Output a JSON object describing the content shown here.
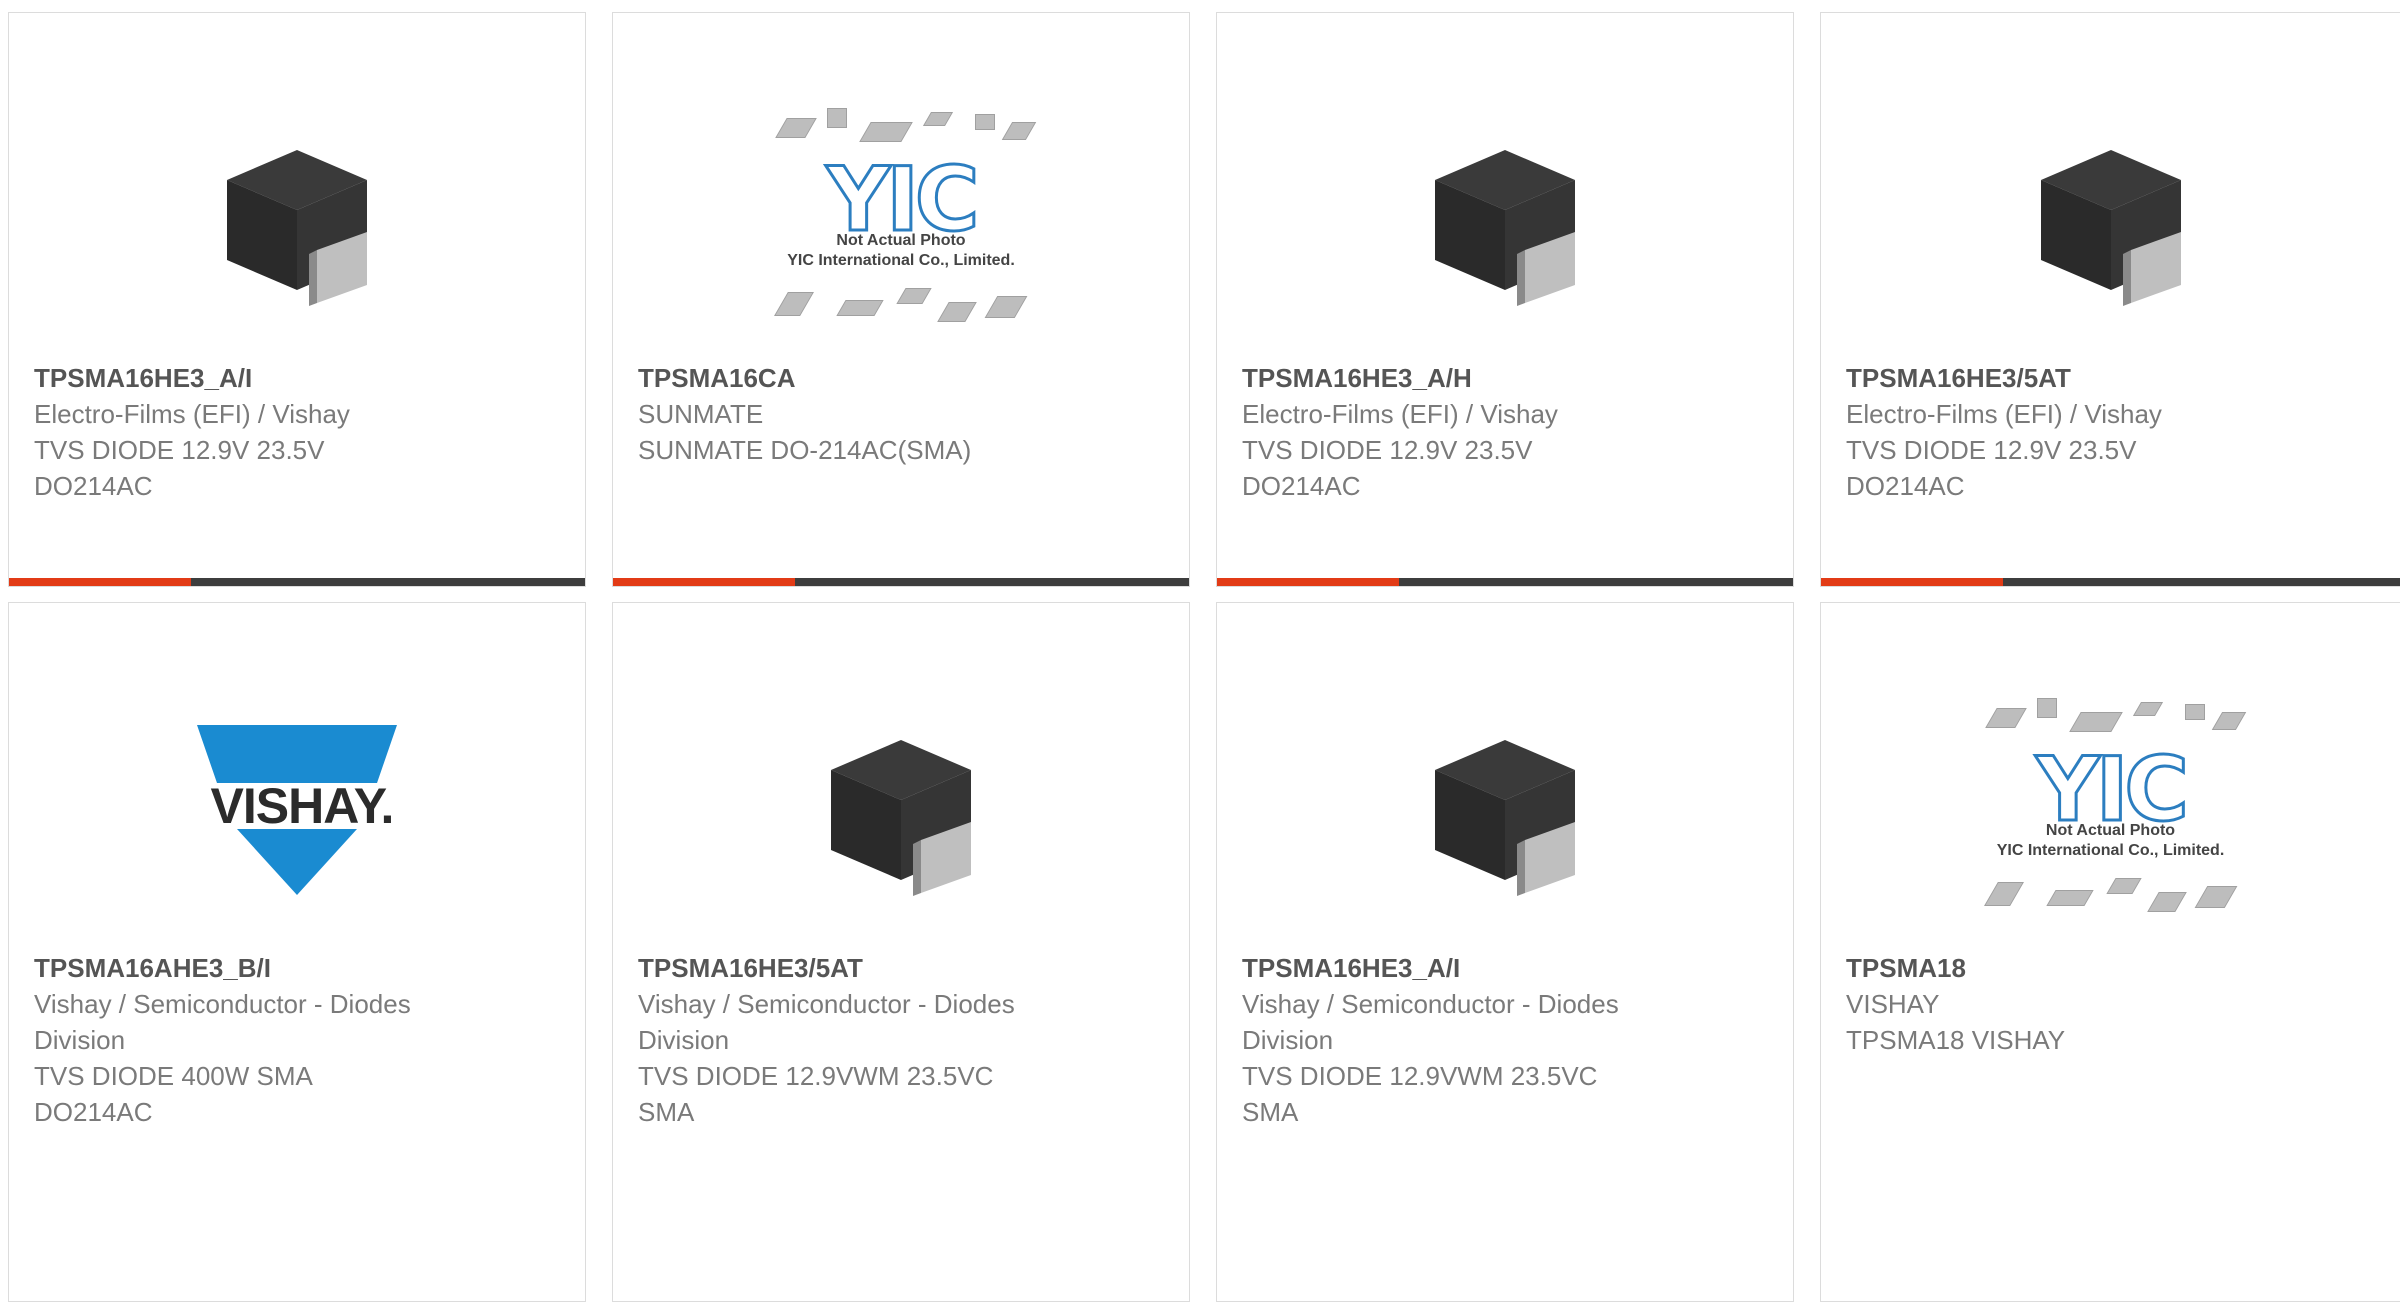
{
  "products": [
    {
      "part_number": "TPSMA16HE3_A/I",
      "lines": [
        "Electro-Films (EFI) / Vishay",
        "TVS DIODE 12.9V 23.5V",
        "DO214AC"
      ],
      "image": "diode-package"
    },
    {
      "part_number": "TPSMA16CA",
      "lines": [
        "SUNMATE",
        "SUNMATE DO-214AC(SMA)"
      ],
      "image": "yic-placeholder"
    },
    {
      "part_number": "TPSMA16HE3_A/H",
      "lines": [
        "Electro-Films (EFI) / Vishay",
        "TVS DIODE 12.9V 23.5V",
        "DO214AC"
      ],
      "image": "diode-package"
    },
    {
      "part_number": "TPSMA16HE3/5AT",
      "lines": [
        "Electro-Films (EFI) / Vishay",
        "TVS DIODE 12.9V 23.5V",
        "DO214AC"
      ],
      "image": "diode-package"
    },
    {
      "part_number": "TPSMA16AHE3_B/I",
      "lines": [
        "Vishay / Semiconductor - Diodes",
        "Division",
        "TVS DIODE 400W SMA",
        "DO214AC"
      ],
      "image": "vishay-logo"
    },
    {
      "part_number": "TPSMA16HE3/5AT",
      "lines": [
        "Vishay / Semiconductor - Diodes",
        "Division",
        "TVS DIODE 12.9VWM 23.5VC",
        "SMA"
      ],
      "image": "diode-package"
    },
    {
      "part_number": "TPSMA16HE3_A/I",
      "lines": [
        "Vishay / Semiconductor - Diodes",
        "Division",
        "TVS DIODE 12.9VWM 23.5VC",
        "SMA"
      ],
      "image": "diode-package"
    },
    {
      "part_number": "TPSMA18",
      "lines": [
        "VISHAY",
        "TPSMA18 VISHAY"
      ],
      "image": "yic-placeholder"
    }
  ],
  "yic_placeholder": {
    "logo_text": "YIC",
    "caption_1": "Not Actual Photo",
    "caption_2": "YIC International Co., Limited."
  },
  "vishay_logo_text": "VISHAY.",
  "colors": {
    "accent": "#e23b16",
    "bar": "#3d3d3d",
    "logo_blue": "#1a8bd1"
  }
}
